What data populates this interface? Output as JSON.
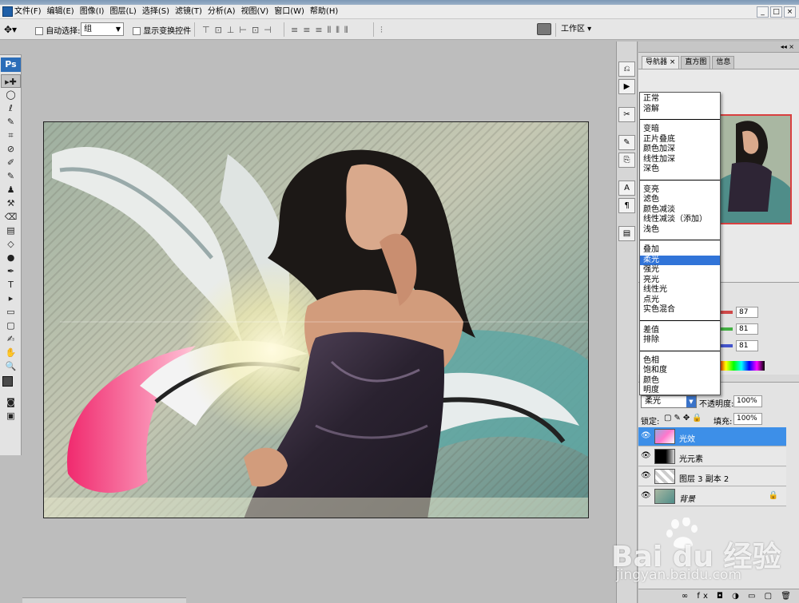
{
  "menubar": {
    "items": [
      "文件(F)",
      "编辑(E)",
      "图像(I)",
      "图层(L)",
      "选择(S)",
      "滤镜(T)",
      "分析(A)",
      "视图(V)",
      "窗口(W)",
      "帮助(H)"
    ],
    "window_buttons": [
      "_",
      "□",
      "×"
    ]
  },
  "options_bar": {
    "auto_select_label": "自动选择:",
    "auto_select_value": "组",
    "show_transform_label": "显示变换控件",
    "workspace_label": "工作区 ▾"
  },
  "tools": [
    "▸✚",
    "◯",
    "ℓ",
    "✎",
    "⌗",
    "⊘",
    "✐",
    "✎",
    "♟",
    "⚒",
    "⌫",
    "▤",
    "◇",
    "●",
    "✒",
    "T",
    "▸",
    "▭",
    "▢",
    "✍",
    "✋",
    "🔍"
  ],
  "navigator": {
    "tabs": [
      "导航器 ×",
      "直方图",
      "信息"
    ]
  },
  "color_panel": {
    "values": [
      "87",
      "81",
      "81"
    ],
    "colors": [
      "#d04848",
      "#44b044",
      "#4455cc"
    ]
  },
  "layers_panel": {
    "blend_mode": "柔光",
    "opacity_label": "不透明度:",
    "opacity_value": "100%",
    "lock_label": "锁定:",
    "fill_label": "填充:",
    "fill_value": "100%",
    "layers": [
      {
        "name": "光效",
        "selected": true
      },
      {
        "name": "光元素",
        "selected": false
      },
      {
        "name": "图层 3 副本 2",
        "selected": false
      },
      {
        "name": "背景",
        "selected": false,
        "locked": true
      }
    ],
    "footer_icons": "∞ fx ◘ ◑ ▭ ▢ 🗑"
  },
  "blend_menu": {
    "groups": [
      [
        "正常",
        "溶解"
      ],
      [
        "变暗",
        "正片叠底",
        "颜色加深",
        "线性加深",
        "深色"
      ],
      [
        "变亮",
        "滤色",
        "颜色减淡",
        "线性减淡（添加）",
        "浅色"
      ],
      [
        "叠加",
        "柔光",
        "强光",
        "亮光",
        "线性光",
        "点光",
        "实色混合"
      ],
      [
        "差值",
        "排除"
      ],
      [
        "色相",
        "饱和度",
        "颜色",
        "明度"
      ]
    ],
    "highlighted": "柔光"
  },
  "watermark": {
    "main": "Bai du 经验",
    "sub": "jingyan.baidu.com"
  }
}
